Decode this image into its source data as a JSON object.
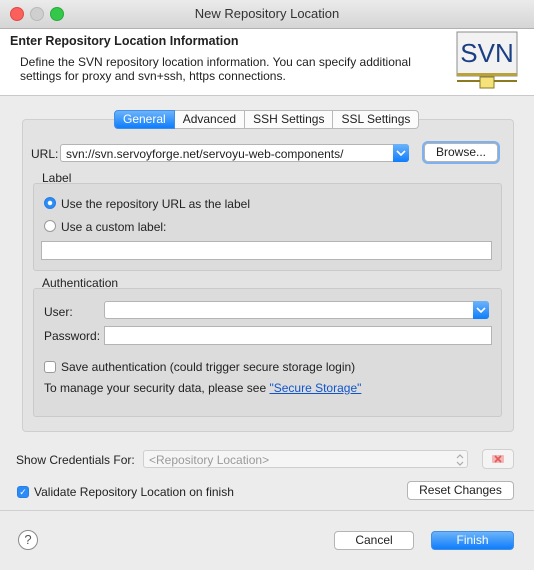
{
  "window": {
    "title": "New Repository Location"
  },
  "header": {
    "title": "Enter Repository Location Information",
    "description": "Define the SVN repository location information. You can specify additional settings for proxy and svn+ssh, https connections.",
    "logo_text": "SVN"
  },
  "tabs": [
    {
      "label": "General",
      "active": true
    },
    {
      "label": "Advanced"
    },
    {
      "label": "SSH Settings"
    },
    {
      "label": "SSL Settings"
    }
  ],
  "url": {
    "label": "URL:",
    "value": "svn://svn.servoyforge.net/servoyu-web-components/",
    "browse_label": "Browse..."
  },
  "label_group": {
    "title": "Label",
    "option_repo": "Use the repository URL as the label",
    "option_custom": "Use a custom label:",
    "custom_value": ""
  },
  "auth_group": {
    "title": "Authentication",
    "user_label": "User:",
    "user_value": "",
    "password_label": "Password:",
    "password_value": "",
    "save_label": "Save authentication (could trigger secure storage login)",
    "manage_text": "To manage your security data, please see ",
    "secure_storage_link": "\"Secure Storage\""
  },
  "credentials": {
    "label": "Show Credentials For:",
    "value": "<Repository Location>"
  },
  "validate_label": "Validate Repository Location on finish",
  "buttons": {
    "reset": "Reset Changes",
    "cancel": "Cancel",
    "finish": "Finish",
    "help": "?"
  },
  "colors": {
    "accent": "#0f7dfb"
  }
}
